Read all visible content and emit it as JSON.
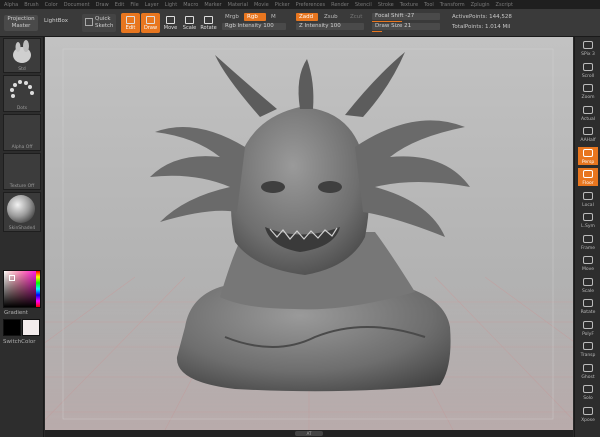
{
  "menu": [
    "Alpha",
    "Brush",
    "Color",
    "Document",
    "Draw",
    "Edit",
    "File",
    "Layer",
    "Light",
    "Macro",
    "Marker",
    "Material",
    "Movie",
    "Picker",
    "Preferences",
    "Render",
    "Stencil",
    "Stroke",
    "Texture",
    "Tool",
    "Transform",
    "Zplugin",
    "Zscript"
  ],
  "shelf": {
    "projection_master": "Projection Master",
    "lightbox": "LightBox",
    "quick_sketch": "Quick Sketch",
    "tools": [
      {
        "label": "Edit",
        "on": true
      },
      {
        "label": "Draw",
        "on": true
      },
      {
        "label": "Move",
        "on": false
      },
      {
        "label": "Scale",
        "on": false
      },
      {
        "label": "Rotate",
        "on": false
      }
    ],
    "mrgb": "Mrgb",
    "rgb": "Rgb",
    "m": "M",
    "rgb_intensity": "Rgb Intensity 100",
    "zadd": "Zadd",
    "zsub": "Zsub",
    "zcut": "Zcut",
    "z_intensity": "Z Intensity 100",
    "focal_shift": "Focal Shift -27",
    "draw_size": "Draw Size 21",
    "active_points": "ActivePoints: 144,528",
    "total_points": "TotalPoints: 1.014 Mil"
  },
  "left_tray": {
    "brush": "Std",
    "stroke": "Dots",
    "alpha": "Alpha Off",
    "texture": "Texture Off",
    "material": "SkinShade4",
    "gradient": "Gradient",
    "switch_color": "SwitchColor"
  },
  "right_tray": [
    {
      "label": "SPix 3",
      "on": false
    },
    {
      "label": "Scroll",
      "on": false
    },
    {
      "label": "Zoom",
      "on": false
    },
    {
      "label": "Actual",
      "on": false
    },
    {
      "label": "AAHalf",
      "on": false
    },
    {
      "label": "Persp",
      "on": true
    },
    {
      "label": "Floor",
      "on": true
    },
    {
      "label": "Local",
      "on": false
    },
    {
      "label": "L.Sym",
      "on": false
    },
    {
      "label": "Frame",
      "on": false
    },
    {
      "label": "Move",
      "on": false
    },
    {
      "label": "Scale",
      "on": false
    },
    {
      "label": "Rotate",
      "on": false
    },
    {
      "label": "PolyF",
      "on": false
    },
    {
      "label": "Transp",
      "on": false
    },
    {
      "label": "Ghost",
      "on": false
    },
    {
      "label": "Solo",
      "on": false
    },
    {
      "label": "Xpose",
      "on": false
    }
  ],
  "bottom": {
    "handle": "AT"
  },
  "colors": {
    "accent": "#e8761f",
    "main_color": "#ffffff",
    "secondary_color": "#000000"
  }
}
